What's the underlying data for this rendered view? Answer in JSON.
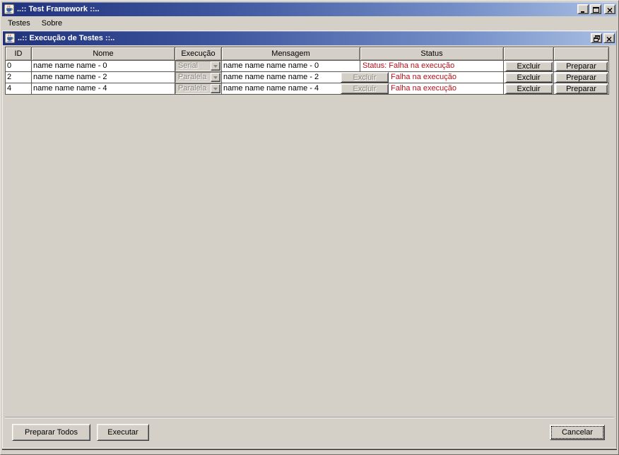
{
  "colors": {
    "chrome": "#d4d0c8",
    "titlebar_left": "#21327c",
    "titlebar_right": "#aabfe3",
    "status_red": "#b51219",
    "row_bg": "#ffffff",
    "grid": "#5a574f",
    "disabled_text": "#8a8780"
  },
  "window": {
    "title": "..:: Test Framework ::..",
    "icon": "java-cup-icon",
    "controls": [
      "minimize-icon",
      "maximize-icon",
      "close-icon"
    ]
  },
  "menubar": {
    "items": [
      {
        "label": "Testes"
      },
      {
        "label": "Sobre"
      }
    ]
  },
  "internal_frame": {
    "title": "..:: Execução de Testes ::..",
    "icon": "java-cup-icon",
    "controls": [
      "restore-icon",
      "close-icon"
    ]
  },
  "table": {
    "headers": [
      "ID",
      "Nome",
      "Execução",
      "Mensagem",
      "Status",
      "",
      ""
    ],
    "rows": [
      {
        "id": "0",
        "nome": "name name name - 0",
        "execucao": "Serial",
        "mensagem": "name name name name - 0",
        "status": "Status: Falha na execução",
        "excluir": "Excluir",
        "preparar": "Preparar"
      },
      {
        "id": "2",
        "nome": "name name name - 2",
        "execucao": "Paralela",
        "mensagem": "name name name name - 2",
        "inline_excluir": "Excluir",
        "status": "Falha na execução",
        "excluir": "Excluir",
        "preparar": "Preparar"
      },
      {
        "id": "4",
        "nome": "name name name - 4",
        "execucao": "Paralela",
        "mensagem": "name name name name - 4",
        "inline_excluir": "Excluir",
        "status": "Falha na execução",
        "excluir": "Excluir",
        "preparar": "Preparar"
      }
    ]
  },
  "footer": {
    "preparar_todos": "Preparar Todos",
    "executar": "Executar",
    "cancelar": "Cancelar"
  }
}
